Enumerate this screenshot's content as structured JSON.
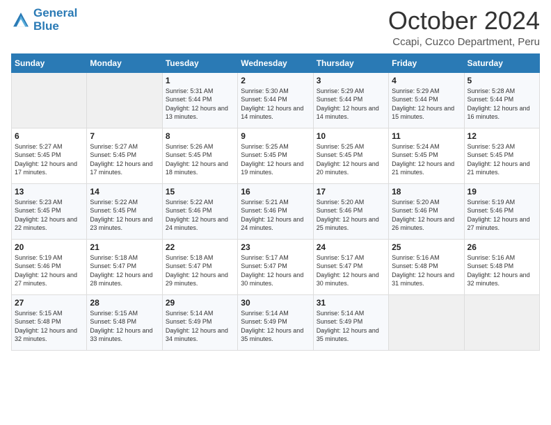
{
  "header": {
    "logo_line1": "General",
    "logo_line2": "Blue",
    "month": "October 2024",
    "location": "Ccapi, Cuzco Department, Peru"
  },
  "days_of_week": [
    "Sunday",
    "Monday",
    "Tuesday",
    "Wednesday",
    "Thursday",
    "Friday",
    "Saturday"
  ],
  "weeks": [
    [
      {
        "day": "",
        "sunrise": "",
        "sunset": "",
        "daylight": ""
      },
      {
        "day": "",
        "sunrise": "",
        "sunset": "",
        "daylight": ""
      },
      {
        "day": "1",
        "sunrise": "Sunrise: 5:31 AM",
        "sunset": "Sunset: 5:44 PM",
        "daylight": "Daylight: 12 hours and 13 minutes."
      },
      {
        "day": "2",
        "sunrise": "Sunrise: 5:30 AM",
        "sunset": "Sunset: 5:44 PM",
        "daylight": "Daylight: 12 hours and 14 minutes."
      },
      {
        "day": "3",
        "sunrise": "Sunrise: 5:29 AM",
        "sunset": "Sunset: 5:44 PM",
        "daylight": "Daylight: 12 hours and 14 minutes."
      },
      {
        "day": "4",
        "sunrise": "Sunrise: 5:29 AM",
        "sunset": "Sunset: 5:44 PM",
        "daylight": "Daylight: 12 hours and 15 minutes."
      },
      {
        "day": "5",
        "sunrise": "Sunrise: 5:28 AM",
        "sunset": "Sunset: 5:44 PM",
        "daylight": "Daylight: 12 hours and 16 minutes."
      }
    ],
    [
      {
        "day": "6",
        "sunrise": "Sunrise: 5:27 AM",
        "sunset": "Sunset: 5:45 PM",
        "daylight": "Daylight: 12 hours and 17 minutes."
      },
      {
        "day": "7",
        "sunrise": "Sunrise: 5:27 AM",
        "sunset": "Sunset: 5:45 PM",
        "daylight": "Daylight: 12 hours and 17 minutes."
      },
      {
        "day": "8",
        "sunrise": "Sunrise: 5:26 AM",
        "sunset": "Sunset: 5:45 PM",
        "daylight": "Daylight: 12 hours and 18 minutes."
      },
      {
        "day": "9",
        "sunrise": "Sunrise: 5:25 AM",
        "sunset": "Sunset: 5:45 PM",
        "daylight": "Daylight: 12 hours and 19 minutes."
      },
      {
        "day": "10",
        "sunrise": "Sunrise: 5:25 AM",
        "sunset": "Sunset: 5:45 PM",
        "daylight": "Daylight: 12 hours and 20 minutes."
      },
      {
        "day": "11",
        "sunrise": "Sunrise: 5:24 AM",
        "sunset": "Sunset: 5:45 PM",
        "daylight": "Daylight: 12 hours and 21 minutes."
      },
      {
        "day": "12",
        "sunrise": "Sunrise: 5:23 AM",
        "sunset": "Sunset: 5:45 PM",
        "daylight": "Daylight: 12 hours and 21 minutes."
      }
    ],
    [
      {
        "day": "13",
        "sunrise": "Sunrise: 5:23 AM",
        "sunset": "Sunset: 5:45 PM",
        "daylight": "Daylight: 12 hours and 22 minutes."
      },
      {
        "day": "14",
        "sunrise": "Sunrise: 5:22 AM",
        "sunset": "Sunset: 5:45 PM",
        "daylight": "Daylight: 12 hours and 23 minutes."
      },
      {
        "day": "15",
        "sunrise": "Sunrise: 5:22 AM",
        "sunset": "Sunset: 5:46 PM",
        "daylight": "Daylight: 12 hours and 24 minutes."
      },
      {
        "day": "16",
        "sunrise": "Sunrise: 5:21 AM",
        "sunset": "Sunset: 5:46 PM",
        "daylight": "Daylight: 12 hours and 24 minutes."
      },
      {
        "day": "17",
        "sunrise": "Sunrise: 5:20 AM",
        "sunset": "Sunset: 5:46 PM",
        "daylight": "Daylight: 12 hours and 25 minutes."
      },
      {
        "day": "18",
        "sunrise": "Sunrise: 5:20 AM",
        "sunset": "Sunset: 5:46 PM",
        "daylight": "Daylight: 12 hours and 26 minutes."
      },
      {
        "day": "19",
        "sunrise": "Sunrise: 5:19 AM",
        "sunset": "Sunset: 5:46 PM",
        "daylight": "Daylight: 12 hours and 27 minutes."
      }
    ],
    [
      {
        "day": "20",
        "sunrise": "Sunrise: 5:19 AM",
        "sunset": "Sunset: 5:46 PM",
        "daylight": "Daylight: 12 hours and 27 minutes."
      },
      {
        "day": "21",
        "sunrise": "Sunrise: 5:18 AM",
        "sunset": "Sunset: 5:47 PM",
        "daylight": "Daylight: 12 hours and 28 minutes."
      },
      {
        "day": "22",
        "sunrise": "Sunrise: 5:18 AM",
        "sunset": "Sunset: 5:47 PM",
        "daylight": "Daylight: 12 hours and 29 minutes."
      },
      {
        "day": "23",
        "sunrise": "Sunrise: 5:17 AM",
        "sunset": "Sunset: 5:47 PM",
        "daylight": "Daylight: 12 hours and 30 minutes."
      },
      {
        "day": "24",
        "sunrise": "Sunrise: 5:17 AM",
        "sunset": "Sunset: 5:47 PM",
        "daylight": "Daylight: 12 hours and 30 minutes."
      },
      {
        "day": "25",
        "sunrise": "Sunrise: 5:16 AM",
        "sunset": "Sunset: 5:48 PM",
        "daylight": "Daylight: 12 hours and 31 minutes."
      },
      {
        "day": "26",
        "sunrise": "Sunrise: 5:16 AM",
        "sunset": "Sunset: 5:48 PM",
        "daylight": "Daylight: 12 hours and 32 minutes."
      }
    ],
    [
      {
        "day": "27",
        "sunrise": "Sunrise: 5:15 AM",
        "sunset": "Sunset: 5:48 PM",
        "daylight": "Daylight: 12 hours and 32 minutes."
      },
      {
        "day": "28",
        "sunrise": "Sunrise: 5:15 AM",
        "sunset": "Sunset: 5:48 PM",
        "daylight": "Daylight: 12 hours and 33 minutes."
      },
      {
        "day": "29",
        "sunrise": "Sunrise: 5:14 AM",
        "sunset": "Sunset: 5:49 PM",
        "daylight": "Daylight: 12 hours and 34 minutes."
      },
      {
        "day": "30",
        "sunrise": "Sunrise: 5:14 AM",
        "sunset": "Sunset: 5:49 PM",
        "daylight": "Daylight: 12 hours and 35 minutes."
      },
      {
        "day": "31",
        "sunrise": "Sunrise: 5:14 AM",
        "sunset": "Sunset: 5:49 PM",
        "daylight": "Daylight: 12 hours and 35 minutes."
      },
      {
        "day": "",
        "sunrise": "",
        "sunset": "",
        "daylight": ""
      },
      {
        "day": "",
        "sunrise": "",
        "sunset": "",
        "daylight": ""
      }
    ]
  ]
}
